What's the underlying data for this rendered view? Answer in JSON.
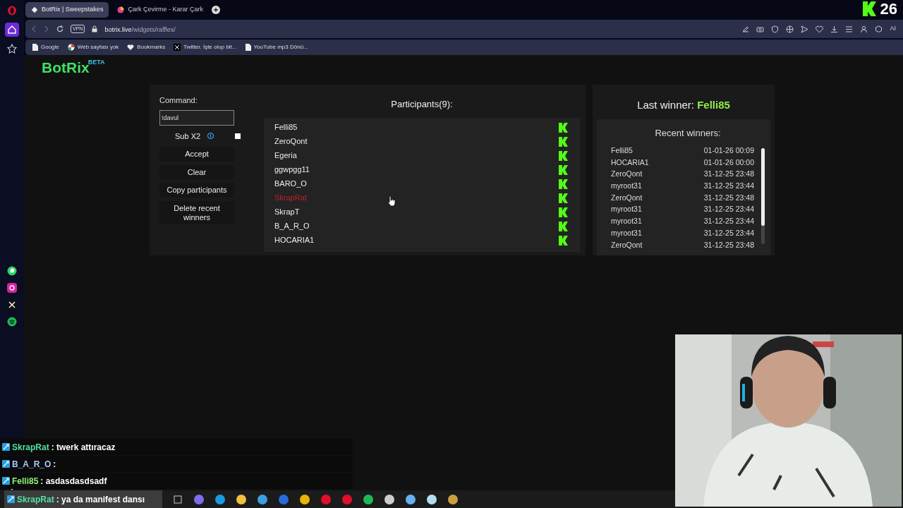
{
  "browser": {
    "tabs": [
      {
        "label": "BotRix | Sweepstakes",
        "selected": true
      },
      {
        "label": "Çark Çevirme - Karar Çark",
        "selected": false
      }
    ],
    "vpn": "VPN",
    "address_host": "botrix.live",
    "address_path": "/widgets/raffles/",
    "ai_label": "AI",
    "bookmarks": [
      "Google",
      "Web sayfası yok",
      "Bookmarks",
      "Twitter. İşte olup bit...",
      "YouTube mp3 Dönü..."
    ]
  },
  "logo": {
    "name": "BotRix",
    "badge": "BETA"
  },
  "raffle": {
    "command_label": "Command:",
    "command_value": "!davul",
    "sub_x2": {
      "label": "Sub X2",
      "checked": false
    },
    "buttons": [
      "Accept",
      "Clear",
      "Copy participants",
      "Delete recent winners"
    ],
    "participants_title": "Participants(9):",
    "participants": [
      {
        "name": "Felli85",
        "removed": false
      },
      {
        "name": "ZeroQont",
        "removed": false
      },
      {
        "name": "Egeria",
        "removed": false
      },
      {
        "name": "ggwpgg11",
        "removed": false
      },
      {
        "name": "BARO_O",
        "removed": false
      },
      {
        "name": "SkrapRat",
        "removed": true
      },
      {
        "name": "SkrapT",
        "removed": false
      },
      {
        "name": "B_A_R_O",
        "removed": false
      },
      {
        "name": "HOCARIA1",
        "removed": false
      }
    ]
  },
  "winners": {
    "last_label": "Last winner:",
    "last_name": "Felli85",
    "recent_title": "Recent winners:",
    "rows": [
      {
        "name": "Felli85",
        "time": "01-01-26 00:09"
      },
      {
        "name": "HOCARIA1",
        "time": "01-01-26 00:00"
      },
      {
        "name": "ZeroQont",
        "time": "31-12-25 23:48"
      },
      {
        "name": "myroot31",
        "time": "31-12-25 23:44"
      },
      {
        "name": "ZeroQont",
        "time": "31-12-25 23:48"
      },
      {
        "name": "myroot31",
        "time": "31-12-25 23:44"
      },
      {
        "name": "myroot31",
        "time": "31-12-25 23:44"
      },
      {
        "name": "myroot31",
        "time": "31-12-25 23:44"
      },
      {
        "name": "ZeroQont",
        "time": "31-12-25 23:48"
      }
    ]
  },
  "chat": [
    {
      "user": "SkrapRat",
      "text": ": twerk attıracaz",
      "color": "#53e0a0"
    },
    {
      "user": "B_A_R_O",
      "text": ":",
      "color": "#a9c7ff"
    },
    {
      "user": "Felli85",
      "text": ": asdasdasdsadf",
      "color": "#8ef07a"
    },
    {
      "user": "SkrapRat",
      "text": ": ya da manifest dansı",
      "color": "#53e0a0"
    }
  ],
  "counter": "26"
}
